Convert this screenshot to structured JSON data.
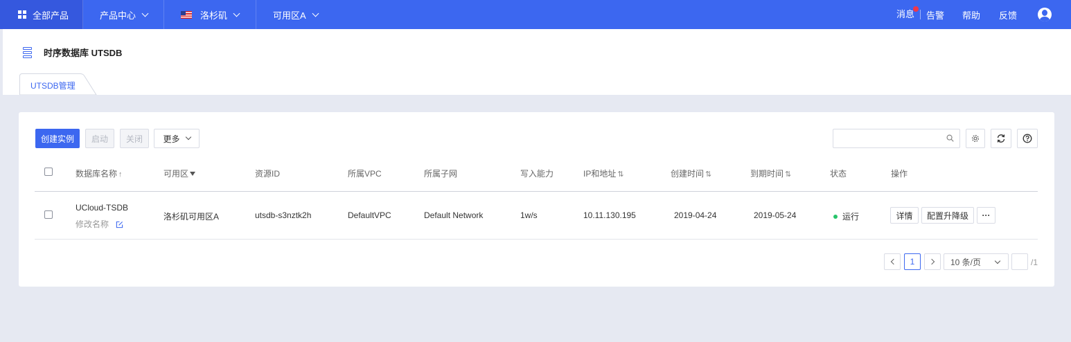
{
  "topbar": {
    "all_products": "全部产品",
    "product_center": "产品中心",
    "region": "洛杉矶",
    "zone": "可用区A",
    "messages": "消息",
    "alerts": "告警",
    "help": "帮助",
    "feedback": "反馈"
  },
  "page": {
    "title": "时序数据库 UTSDB",
    "tab_label": "UTSDB管理"
  },
  "toolbar": {
    "create_label": "创建实例",
    "start_label": "启动",
    "stop_label": "关闭",
    "more_label": "更多",
    "search_placeholder": ""
  },
  "table": {
    "headers": {
      "name": "数据库名称",
      "zone": "可用区",
      "resource_id": "资源ID",
      "vpc": "所属VPC",
      "subnet": "所属子网",
      "write_capacity": "写入能力",
      "ip": "IP和地址",
      "created": "创建时间",
      "expires": "到期时间",
      "status": "状态",
      "actions": "操作"
    },
    "rows": [
      {
        "name": "UCloud-TSDB",
        "rename": "修改名称",
        "zone": "洛杉矶可用区A",
        "resource_id": "utsdb-s3nztk2h",
        "vpc": "DefaultVPC",
        "subnet": "Default Network",
        "write_capacity": "1w/s",
        "ip": "10.11.130.195",
        "created": "2019-04-24",
        "expires": "2019-05-24",
        "status": "运行",
        "detail_label": "详情",
        "resize_label": "配置升降级",
        "more_label": "···"
      }
    ]
  },
  "pagination": {
    "current_page": "1",
    "page_size": "10 条/页",
    "total_pages": "/1"
  },
  "colors": {
    "brand": "#3c67f0",
    "status_running": "#27c46a",
    "notification": "#f0364a"
  }
}
